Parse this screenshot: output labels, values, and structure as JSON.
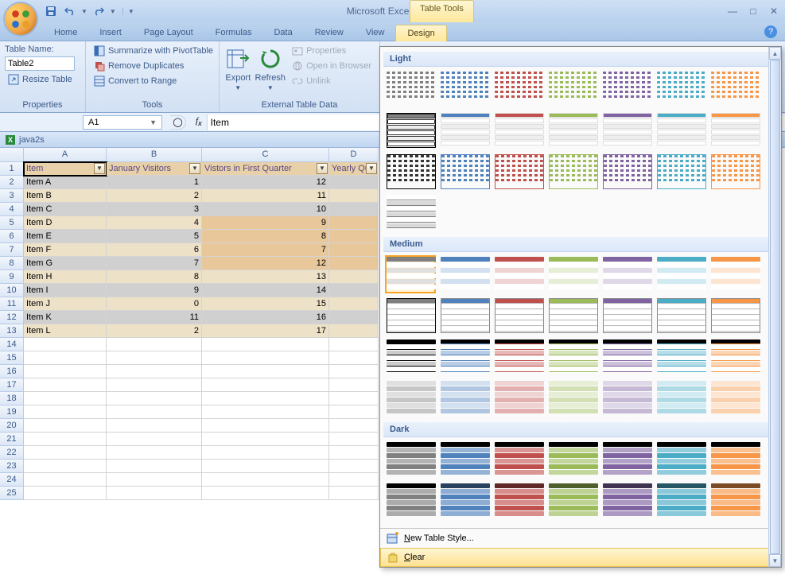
{
  "app": {
    "title": "Microsoft Excel (Trial)",
    "tools_context": "Table Tools"
  },
  "qat": {
    "save": "Save",
    "undo": "Undo",
    "redo": "Redo"
  },
  "tabs": [
    "Home",
    "Insert",
    "Page Layout",
    "Formulas",
    "Data",
    "Review",
    "View",
    "Design"
  ],
  "active_tab": "Design",
  "ribbon": {
    "properties": {
      "label": "Properties",
      "table_name_label": "Table Name:",
      "table_name_value": "Table2",
      "resize": "Resize Table"
    },
    "tools": {
      "label": "Tools",
      "pivot": "Summarize with PivotTable",
      "dup": "Remove Duplicates",
      "range": "Convert to Range"
    },
    "external": {
      "label": "External Table Data",
      "export": "Export",
      "refresh": "Refresh",
      "props": "Properties",
      "browser": "Open in Browser",
      "unlink": "Unlink"
    }
  },
  "namebox": "A1",
  "formula": "Item",
  "workbook": "java2s",
  "cols": [
    "A",
    "B",
    "C",
    "D"
  ],
  "headers": [
    "Item",
    "January Visitors",
    "Vistors in First Quarter",
    "Yearly Qu"
  ],
  "rows": [
    {
      "n": 2,
      "a": "Item A",
      "b": "1",
      "c": "12"
    },
    {
      "n": 3,
      "a": "Item B",
      "b": "2",
      "c": "11"
    },
    {
      "n": 4,
      "a": "Item C",
      "b": "3",
      "c": "10"
    },
    {
      "n": 5,
      "a": "Item D",
      "b": "4",
      "c": "9",
      "hl": true
    },
    {
      "n": 6,
      "a": "Item E",
      "b": "5",
      "c": "8",
      "hl": true
    },
    {
      "n": 7,
      "a": "Item F",
      "b": "6",
      "c": "7",
      "hl": true
    },
    {
      "n": 8,
      "a": "Item G",
      "b": "7",
      "c": "12",
      "hl": true
    },
    {
      "n": 9,
      "a": "Item H",
      "b": "8",
      "c": "13"
    },
    {
      "n": 10,
      "a": "Item I",
      "b": "9",
      "c": "14"
    },
    {
      "n": 11,
      "a": "Item J",
      "b": "0",
      "c": "15"
    },
    {
      "n": 12,
      "a": "Item K",
      "b": "11",
      "c": "16"
    },
    {
      "n": 13,
      "a": "Item L",
      "b": "2",
      "c": "17"
    }
  ],
  "empty_rows": [
    14,
    15,
    16,
    17,
    18,
    19,
    20,
    21,
    22,
    23,
    24,
    25
  ],
  "gallery": {
    "cats": {
      "light": "Light",
      "medium": "Medium",
      "dark": "Dark"
    },
    "new_style": "New Table Style...",
    "clear": "Clear",
    "palette": [
      "#808080",
      "#4f81bd",
      "#c0504d",
      "#9bbb59",
      "#8064a2",
      "#4bacc6",
      "#f79646"
    ]
  }
}
